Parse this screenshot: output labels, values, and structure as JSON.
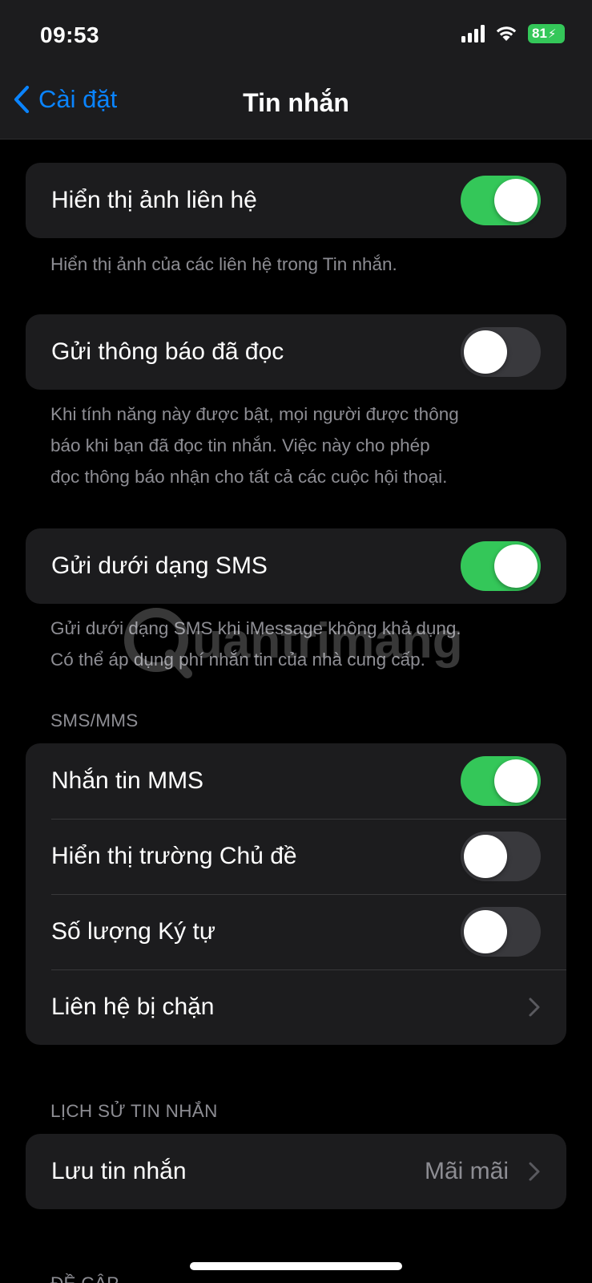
{
  "status_bar": {
    "time": "09:53",
    "battery": "81"
  },
  "nav": {
    "back_label": "Cài đặt",
    "title": "Tin nhắn"
  },
  "settings": {
    "contact_photos": {
      "label": "Hiển thị ảnh liên hệ",
      "enabled": true,
      "footnote": "Hiển thị ảnh của các liên hệ trong Tin nhắn."
    },
    "read_receipts": {
      "label": "Gửi thông báo đã đọc",
      "enabled": false,
      "footnote_lines": [
        "Khi tính năng này được bật, mọi người được thông",
        "báo khi bạn đã đọc tin nhắn. Việc này cho phép",
        "đọc thông báo nhận cho tất cả các cuộc hội thoại."
      ]
    },
    "send_as_sms": {
      "label": "Gửi dưới dạng SMS",
      "enabled": true,
      "footnote_lines": [
        "Gửi dưới dạng SMS khi iMessage không khả dụng.",
        "Có thể áp dụng phí nhắn tin của nhà cung cấp."
      ]
    }
  },
  "sms_mms": {
    "header": "SMS/MMS",
    "mms_messaging": {
      "label": "Nhắn tin MMS",
      "enabled": true
    },
    "show_subject": {
      "label": "Hiển thị trường Chủ đề",
      "enabled": false
    },
    "character_count": {
      "label": "Số lượng Ký tự",
      "enabled": false
    },
    "blocked_contacts": {
      "label": "Liên hệ bị chặn"
    }
  },
  "message_history": {
    "header": "LỊCH SỬ TIN NHẮN",
    "keep_messages": {
      "label": "Lưu tin nhắn",
      "value": "Mãi mãi"
    }
  },
  "cut_off_header": "ĐỀ CẬP",
  "watermark_text": "uantrimang",
  "colors": {
    "accent": "#0a84ff",
    "toggle_on": "#34c759",
    "toggle_off": "#39393d",
    "cell_background": "#1c1c1e",
    "secondary_text": "#8d8d93"
  }
}
